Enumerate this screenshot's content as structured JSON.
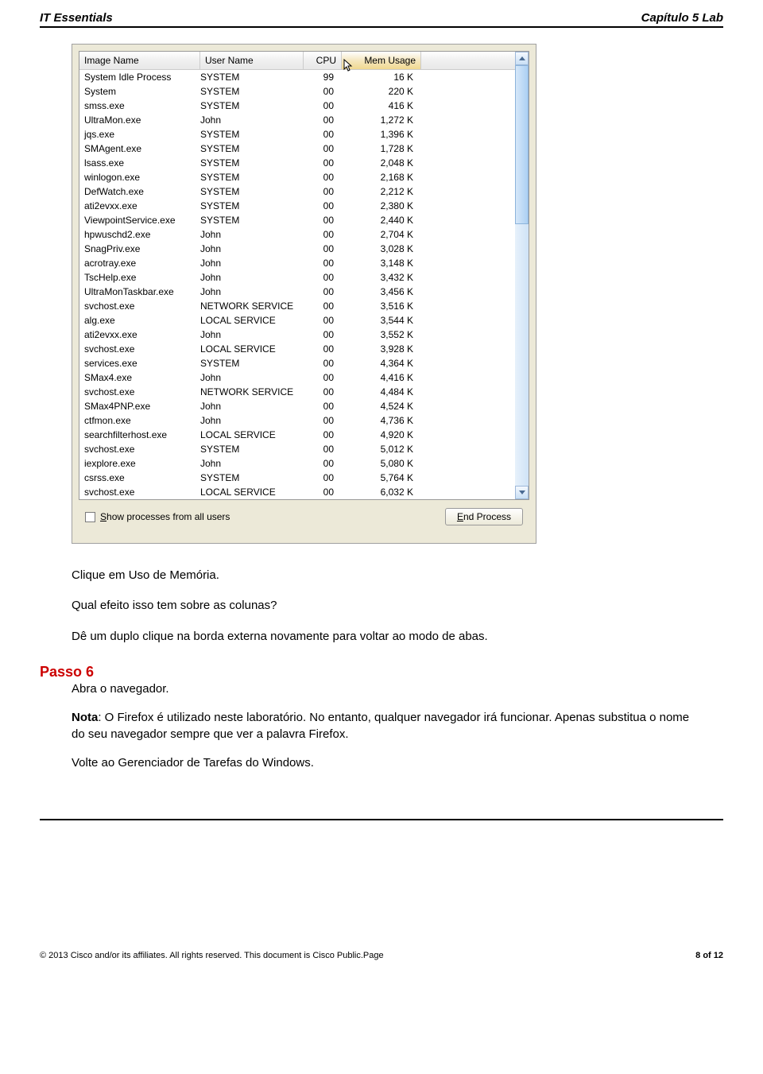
{
  "header": {
    "left": "IT Essentials",
    "right": "Capítulo 5 Lab"
  },
  "task_manager": {
    "columns": {
      "image": "Image Name",
      "user": "User Name",
      "cpu": "CPU",
      "mem": "Mem Usage"
    },
    "rows": [
      {
        "image": "System Idle Process",
        "user": "SYSTEM",
        "cpu": "99",
        "mem": "16 K"
      },
      {
        "image": "System",
        "user": "SYSTEM",
        "cpu": "00",
        "mem": "220 K"
      },
      {
        "image": "smss.exe",
        "user": "SYSTEM",
        "cpu": "00",
        "mem": "416 K"
      },
      {
        "image": "UltraMon.exe",
        "user": "John",
        "cpu": "00",
        "mem": "1,272 K"
      },
      {
        "image": "jqs.exe",
        "user": "SYSTEM",
        "cpu": "00",
        "mem": "1,396 K"
      },
      {
        "image": "SMAgent.exe",
        "user": "SYSTEM",
        "cpu": "00",
        "mem": "1,728 K"
      },
      {
        "image": "lsass.exe",
        "user": "SYSTEM",
        "cpu": "00",
        "mem": "2,048 K"
      },
      {
        "image": "winlogon.exe",
        "user": "SYSTEM",
        "cpu": "00",
        "mem": "2,168 K"
      },
      {
        "image": "DefWatch.exe",
        "user": "SYSTEM",
        "cpu": "00",
        "mem": "2,212 K"
      },
      {
        "image": "ati2evxx.exe",
        "user": "SYSTEM",
        "cpu": "00",
        "mem": "2,380 K"
      },
      {
        "image": "ViewpointService.exe",
        "user": "SYSTEM",
        "cpu": "00",
        "mem": "2,440 K"
      },
      {
        "image": "hpwuschd2.exe",
        "user": "John",
        "cpu": "00",
        "mem": "2,704 K"
      },
      {
        "image": "SnagPriv.exe",
        "user": "John",
        "cpu": "00",
        "mem": "3,028 K"
      },
      {
        "image": "acrotray.exe",
        "user": "John",
        "cpu": "00",
        "mem": "3,148 K"
      },
      {
        "image": "TscHelp.exe",
        "user": "John",
        "cpu": "00",
        "mem": "3,432 K"
      },
      {
        "image": "UltraMonTaskbar.exe",
        "user": "John",
        "cpu": "00",
        "mem": "3,456 K"
      },
      {
        "image": "svchost.exe",
        "user": "NETWORK SERVICE",
        "cpu": "00",
        "mem": "3,516 K"
      },
      {
        "image": "alg.exe",
        "user": "LOCAL SERVICE",
        "cpu": "00",
        "mem": "3,544 K"
      },
      {
        "image": "ati2evxx.exe",
        "user": "John",
        "cpu": "00",
        "mem": "3,552 K"
      },
      {
        "image": "svchost.exe",
        "user": "LOCAL SERVICE",
        "cpu": "00",
        "mem": "3,928 K"
      },
      {
        "image": "services.exe",
        "user": "SYSTEM",
        "cpu": "00",
        "mem": "4,364 K"
      },
      {
        "image": "SMax4.exe",
        "user": "John",
        "cpu": "00",
        "mem": "4,416 K"
      },
      {
        "image": "svchost.exe",
        "user": "NETWORK SERVICE",
        "cpu": "00",
        "mem": "4,484 K"
      },
      {
        "image": "SMax4PNP.exe",
        "user": "John",
        "cpu": "00",
        "mem": "4,524 K"
      },
      {
        "image": "ctfmon.exe",
        "user": "John",
        "cpu": "00",
        "mem": "4,736 K"
      },
      {
        "image": "searchfilterhost.exe",
        "user": "LOCAL SERVICE",
        "cpu": "00",
        "mem": "4,920 K"
      },
      {
        "image": "svchost.exe",
        "user": "SYSTEM",
        "cpu": "00",
        "mem": "5,012 K"
      },
      {
        "image": "iexplore.exe",
        "user": "John",
        "cpu": "00",
        "mem": "5,080 K"
      },
      {
        "image": "csrss.exe",
        "user": "SYSTEM",
        "cpu": "00",
        "mem": "5,764 K"
      },
      {
        "image": "svchost.exe",
        "user": "LOCAL SERVICE",
        "cpu": "00",
        "mem": "6,032 K"
      }
    ],
    "show_all_prefix": "S",
    "show_all_suffix": "how processes from all users",
    "end_process_prefix": "E",
    "end_process_suffix": "nd Process"
  },
  "body": {
    "p1": "Clique em Uso de Memória.",
    "p2": "Qual efeito isso tem sobre as colunas?",
    "p3": "Dê um duplo clique na borda externa novamente para voltar ao modo de abas."
  },
  "step": {
    "label": "Passo 6",
    "p1": "Abra o navegador.",
    "note_label": "Nota",
    "note_rest": ": O Firefox é utilizado neste laboratório. No entanto, qualquer navegador irá funcionar. Apenas substitua o nome do seu navegador sempre que ver a palavra Firefox.",
    "p3": "Volte ao Gerenciador de Tarefas do Windows."
  },
  "footer": {
    "left": "© 2013 Cisco and/or its affiliates. All rights reserved. This document is Cisco Public.Page",
    "right": "8 of 12"
  }
}
